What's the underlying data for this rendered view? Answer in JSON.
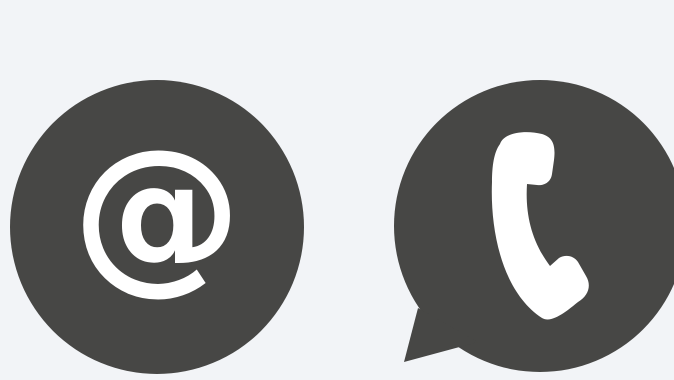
{
  "icons": {
    "email": {
      "name": "at-sign-icon",
      "glyph": "@"
    },
    "phone": {
      "name": "phone-speech-bubble-icon"
    }
  },
  "colors": {
    "background": "#f2f4f7",
    "badge": "#474745",
    "glyph": "#ffffff"
  }
}
